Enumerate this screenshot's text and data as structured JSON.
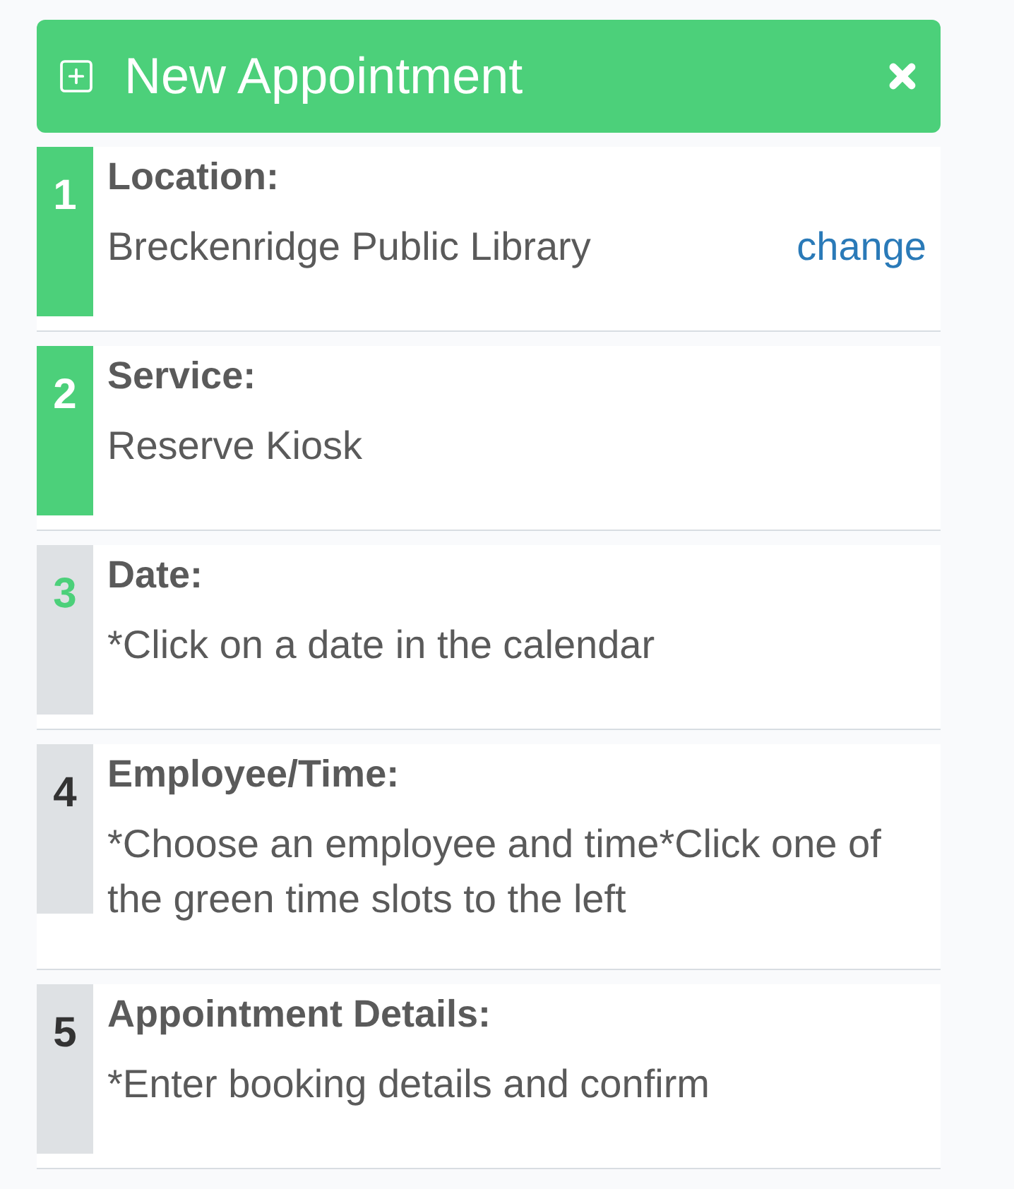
{
  "header": {
    "title": "New Appointment"
  },
  "steps": [
    {
      "number": "1",
      "label": "Location:",
      "value": "Breckenridge Public Library",
      "completed": true,
      "selected": false,
      "action": "change"
    },
    {
      "number": "2",
      "label": "Service:",
      "value": "Reserve Kiosk",
      "completed": true,
      "selected": false
    },
    {
      "number": "3",
      "label": "Date:",
      "value": "*Click on a date in the calendar",
      "completed": false,
      "selected": true
    },
    {
      "number": "4",
      "label": "Employee/Time:",
      "value": "*Choose an employee and time*Click one of the green time slots to the left",
      "completed": false,
      "selected": false
    },
    {
      "number": "5",
      "label": "Appointment Details:",
      "value": "*Enter booking details and confirm",
      "completed": false,
      "selected": false
    }
  ]
}
